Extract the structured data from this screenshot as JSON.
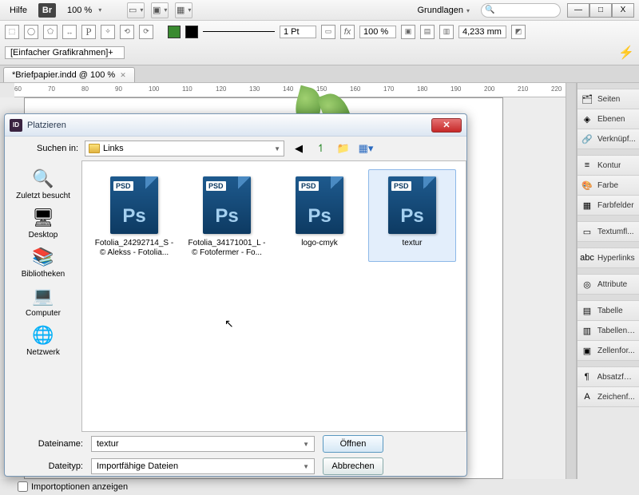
{
  "menubar": {
    "help": "Hilfe",
    "br": "Br",
    "zoom": "100 %",
    "workspace": "Grundlagen"
  },
  "window_buttons": {
    "min": "—",
    "max": "□",
    "close": "X"
  },
  "toolrow": {
    "weight": "1 Pt",
    "pct": "100 %",
    "mm": "4,233 mm",
    "frame_preset": "[Einfacher Grafikrahmen]+"
  },
  "doctab": {
    "title": "*Briefpapier.indd @ 100 %"
  },
  "ruler_ticks": [
    60,
    70,
    80,
    90,
    100,
    110,
    120,
    130,
    140,
    150,
    160,
    170,
    180,
    190,
    200,
    210,
    220
  ],
  "panels": [
    {
      "icon": "🗂",
      "label": "Seiten"
    },
    {
      "icon": "◈",
      "label": "Ebenen"
    },
    {
      "icon": "🔗",
      "label": "Verknüpf..."
    },
    {
      "icon": "≡",
      "label": "Kontur"
    },
    {
      "icon": "🎨",
      "label": "Farbe"
    },
    {
      "icon": "▦",
      "label": "Farbfelder"
    },
    {
      "icon": "▭",
      "label": "Textumfl..."
    },
    {
      "icon": "abc",
      "label": "Hyperlinks"
    },
    {
      "icon": "◎",
      "label": "Attribute"
    },
    {
      "icon": "▤",
      "label": "Tabelle"
    },
    {
      "icon": "▥",
      "label": "Tabellenf..."
    },
    {
      "icon": "▣",
      "label": "Zellenfor..."
    },
    {
      "icon": "¶",
      "label": "Absatzfor..."
    },
    {
      "icon": "A",
      "label": "Zeichenf..."
    }
  ],
  "dialog": {
    "title": "Platzieren",
    "search_in_label": "Suchen in:",
    "folder": "Links",
    "files": [
      {
        "name": "Fotolia_24292714_S - © Alekss - Fotolia...",
        "selected": false
      },
      {
        "name": "Fotolia_34171001_L - © Fotofermer - Fo...",
        "selected": false
      },
      {
        "name": "logo-cmyk",
        "selected": false
      },
      {
        "name": "textur",
        "selected": true
      }
    ],
    "places": [
      {
        "icon": "🔍",
        "label": "Zuletzt besucht"
      },
      {
        "icon": "🖥",
        "label": "Desktop"
      },
      {
        "icon": "📚",
        "label": "Bibliotheken"
      },
      {
        "icon": "💻",
        "label": "Computer"
      },
      {
        "icon": "🌐",
        "label": "Netzwerk"
      }
    ],
    "filename_label": "Dateiname:",
    "filename_value": "textur",
    "filetype_label": "Dateityp:",
    "filetype_value": "Importfähige Dateien",
    "open_btn": "Öffnen",
    "cancel_btn": "Abbrechen",
    "show_import_opts": "Importoptionen anzeigen"
  }
}
